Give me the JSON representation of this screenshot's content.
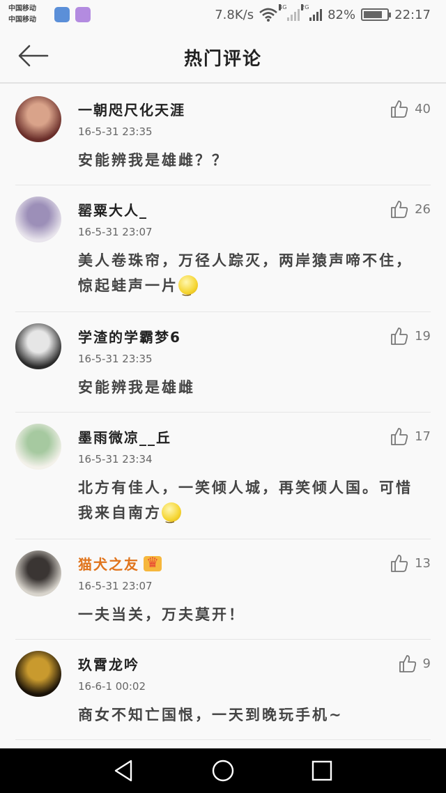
{
  "status_bar": {
    "carrier_1": "中国移动",
    "carrier_2": "中国移动",
    "speed": "7.8K/s",
    "network_1": "4G",
    "network_2": "2G",
    "battery_percent": "82%",
    "battery_level": 0.82,
    "time": "22:17"
  },
  "header": {
    "title": "热门评论",
    "back_icon": "back-arrow-icon"
  },
  "comments": [
    {
      "name": "一朝咫尺化天涯",
      "time": "16-5-31 23:35",
      "text": "安能辨我是雄雌？？",
      "likes": "40",
      "avatar_colors": [
        "#6a2e2a",
        "#d9a38a"
      ],
      "emoji": false,
      "vip": false
    },
    {
      "name": "罂粟大人_",
      "time": "16-5-31 23:07",
      "text": "美人卷珠帘，万径人踪灭，两岸猿声啼不住，惊起蛙声一片",
      "likes": "26",
      "avatar_colors": [
        "#e8e4ec",
        "#9c8fb8"
      ],
      "emoji": true,
      "vip": false
    },
    {
      "name": "学渣的学霸梦6",
      "time": "16-5-31 23:35",
      "text": "安能辨我是雄雌",
      "likes": "19",
      "avatar_colors": [
        "#2b2b2b",
        "#e6e6e6"
      ],
      "emoji": false,
      "vip": false
    },
    {
      "name": "墨雨微凉__丘",
      "time": "16-5-31 23:34",
      "text": "北方有佳人，一笑倾人城，再笑倾人国。可惜我来自南方",
      "likes": "17",
      "avatar_colors": [
        "#f3f1ea",
        "#a6c9a0"
      ],
      "emoji": true,
      "vip": false
    },
    {
      "name": "猫犬之友",
      "time": "16-5-31 23:07",
      "text": "一夫当关，万夫莫开！",
      "likes": "13",
      "avatar_colors": [
        "#d8d4cc",
        "#3a3533"
      ],
      "emoji": false,
      "vip": true
    },
    {
      "name": "玖霄龙吟",
      "time": "16-6-1 00:02",
      "text": "商女不知亡国恨，一天到晚玩手机~",
      "likes": "9",
      "avatar_colors": [
        "#1a1208",
        "#c99a2e"
      ],
      "emoji": false,
      "vip": false
    }
  ],
  "icons": {
    "like": "thumbs-up-icon",
    "emoji": "smile-emoji-icon",
    "vip": "crown-badge-icon"
  },
  "nav": {
    "back": "nav-back-icon",
    "home": "nav-home-icon",
    "recent": "nav-recent-icon"
  },
  "colors": {
    "background": "#f9f9f9",
    "vip_name": "#e0741c",
    "nav_bar": "#000000"
  }
}
